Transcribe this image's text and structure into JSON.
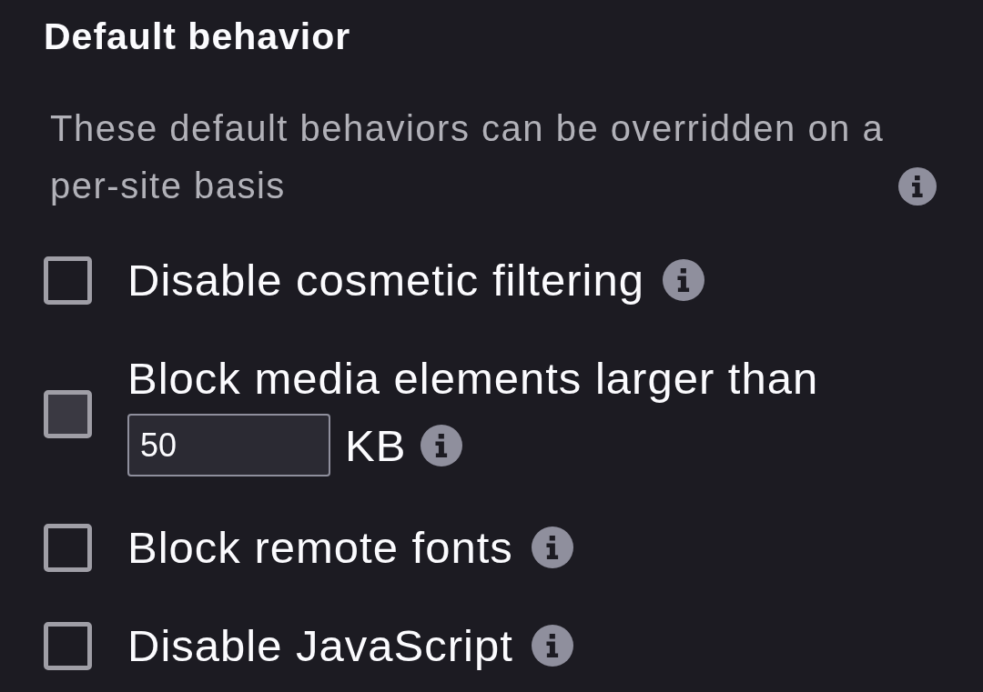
{
  "section": {
    "title": "Default behavior",
    "description": "These default behaviors can be overridden on a per-site basis"
  },
  "options": [
    {
      "kind": "checkbox",
      "label": "Disable cosmetic filtering",
      "checked": false,
      "hovered": false
    },
    {
      "kind": "size-limit",
      "label": "Block media elements larger than",
      "value": "50",
      "unit": "KB",
      "checked": false,
      "hovered": true
    },
    {
      "kind": "checkbox",
      "label": "Block remote fonts",
      "checked": false,
      "hovered": false
    },
    {
      "kind": "checkbox",
      "label": "Disable JavaScript",
      "checked": false,
      "hovered": false
    }
  ]
}
